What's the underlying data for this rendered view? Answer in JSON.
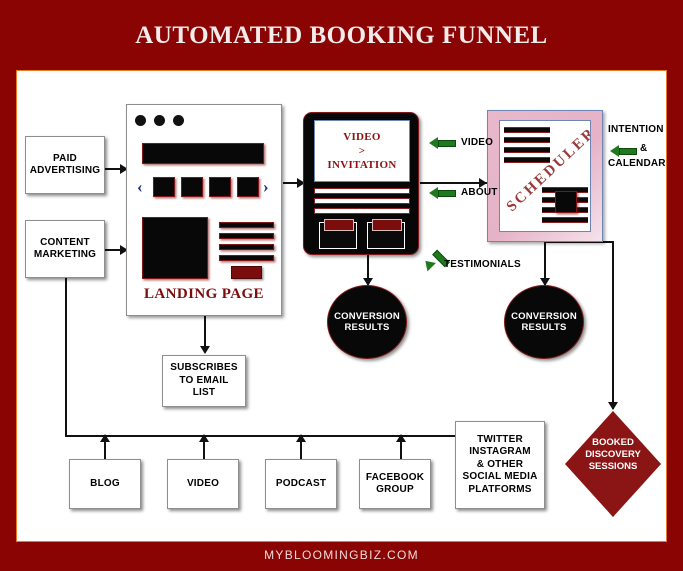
{
  "header": {
    "title": "AUTOMATED BOOKING FUNNEL"
  },
  "footer": {
    "text": "MYBLOOMINGBIZ.COM"
  },
  "colors": {
    "background": "#8b0404",
    "canvas": "#ffffff",
    "canvas_border": "#e87a28",
    "accent_red": "#7c0d0d",
    "diamond": "#8b1414",
    "green_arrow": "#1f7a1f",
    "scheduler_panel": "#e5b2c6",
    "title_text": "#f3eceb"
  },
  "traffic_sources": [
    {
      "label": "PAID ADVERTISING"
    },
    {
      "label": "CONTENT MARKETING"
    }
  ],
  "landing_page": {
    "caption": "LANDING PAGE",
    "browser_dots": 3,
    "carousel_items": 4,
    "prev_icon": "‹",
    "next_icon": "›",
    "text_lines": 4
  },
  "video_invitation": {
    "line1": "VIDEO",
    "line2": ">",
    "line3": "INVITATION",
    "content_lines": 3,
    "panels": 2
  },
  "scheduler": {
    "label": "SCHEDULER",
    "top_rows": 4,
    "bottom_rows": 5
  },
  "callouts": [
    {
      "label": "VIDEO"
    },
    {
      "label": "ABOUT"
    },
    {
      "label": "TESTIMONIALS"
    },
    {
      "label_line1": "INTENTION",
      "label_line2": "&",
      "label_line3": "CALENDAR"
    }
  ],
  "conversion_nodes": [
    {
      "line1": "CONVERSION",
      "line2": "RESULTS"
    },
    {
      "line1": "CONVERSION",
      "line2": "RESULTS"
    }
  ],
  "email_node": {
    "line1": "SUBSCRIBES",
    "line2": "TO  EMAIL",
    "line3": "LIST"
  },
  "booked_node": {
    "line1": "BOOKED",
    "line2": "DISCOVERY",
    "line3": "SESSIONS"
  },
  "channels": [
    {
      "label": "BLOG"
    },
    {
      "label": "VIDEO"
    },
    {
      "label": "PODCAST"
    },
    {
      "label_line1": "FACEBOOK",
      "label_line2": "GROUP"
    }
  ],
  "social_node": {
    "line1": "TWITTER",
    "line2": "INSTAGRAM",
    "line3": "& OTHER",
    "line4": "SOCIAL MEDIA",
    "line5": "PLATFORMS"
  }
}
